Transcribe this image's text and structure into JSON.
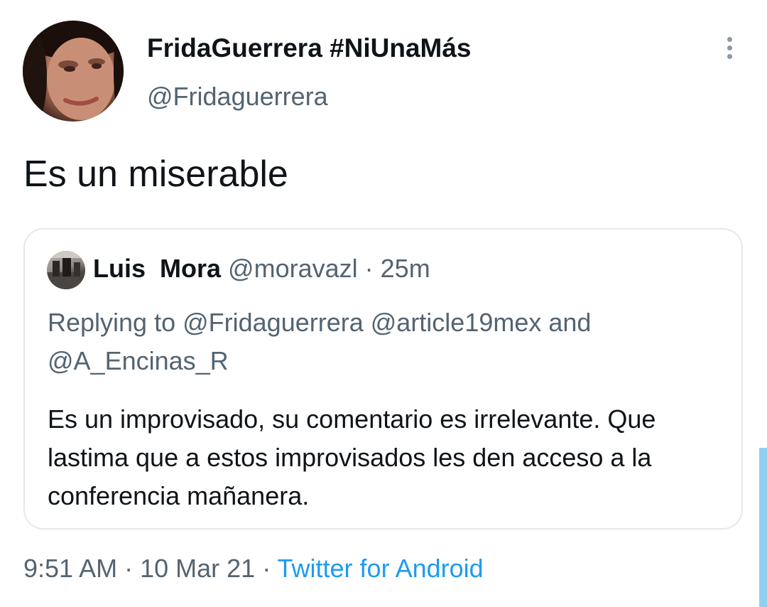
{
  "tweet": {
    "author": {
      "display_name": "FridaGuerrera #NiUnaMás",
      "handle": "@Fridaguerrera"
    },
    "text": "Es un miserable",
    "more_icon": "more-vertical-icon"
  },
  "quoted_tweet": {
    "author_name": "Luis  Mora",
    "author_handle": "@moravazl",
    "separator": "·",
    "time": "25m",
    "reply_line": "Replying to @Fridaguerrera @article19mex and @A_Encinas_R",
    "body": "Es un improvisado, su comentario es irrelevante. Que lastima que a estos improvisados les den acceso a la conferencia mañanera."
  },
  "meta": {
    "time": "9:51 AM",
    "sep1": " · ",
    "date": "10 Mar 21",
    "sep2": " · ",
    "source": "Twitter for Android"
  },
  "colors": {
    "text_primary": "#0f1419",
    "text_secondary": "#536471",
    "link": "#1d9bf0",
    "border": "#e4e8eb",
    "scrollbar": "#8fd0f2"
  }
}
